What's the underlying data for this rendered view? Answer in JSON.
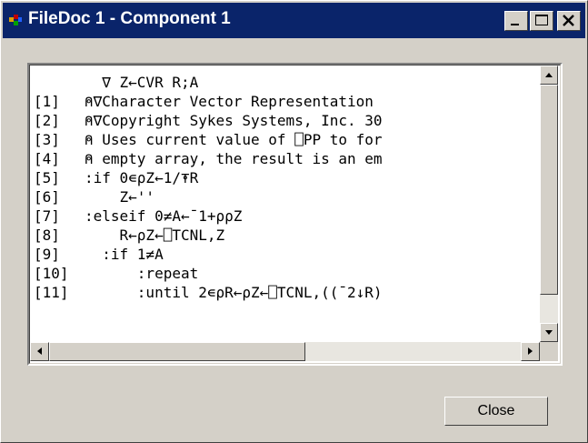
{
  "window": {
    "title": "FileDoc 1 - Component 1",
    "title_bar_color": "#0a246a"
  },
  "icons": {
    "app": "component-app-icon",
    "minimize": "minimize-icon",
    "maximize": "maximize-icon",
    "close": "close-icon",
    "scroll_up": "arrow-up-icon",
    "scroll_down": "arrow-down-icon",
    "scroll_left": "arrow-left-icon",
    "scroll_right": "arrow-right-icon"
  },
  "code": {
    "lines": [
      {
        "num": "",
        "text": "  ∇ Z←CVR R;A"
      },
      {
        "num": "[1]",
        "text": "⍝∇Character Vector Representation"
      },
      {
        "num": "[2]",
        "text": "⍝∇Copyright Sykes Systems, Inc. 30"
      },
      {
        "num": "[3]",
        "text": "⍝ Uses current value of ⎕PP to for"
      },
      {
        "num": "[4]",
        "text": "⍝ empty array, the result is an em"
      },
      {
        "num": "[5]",
        "text": ":if 0∊⍴Z←1/⍕R"
      },
      {
        "num": "[6]",
        "text": "    Z←''"
      },
      {
        "num": "[7]",
        "text": ":elseif 0≠A←¯1+⍴⍴Z"
      },
      {
        "num": "[8]",
        "text": "    R←⍴Z←⎕TCNL,Z"
      },
      {
        "num": "[9]",
        "text": "  :if 1≠A"
      },
      {
        "num": "[10]",
        "text": "      :repeat"
      },
      {
        "num": "[11]",
        "text": "      :until 2∊⍴R←⍴Z←⎕TCNL,((¯2↓R)"
      }
    ]
  },
  "buttons": {
    "close_label": "Close"
  }
}
